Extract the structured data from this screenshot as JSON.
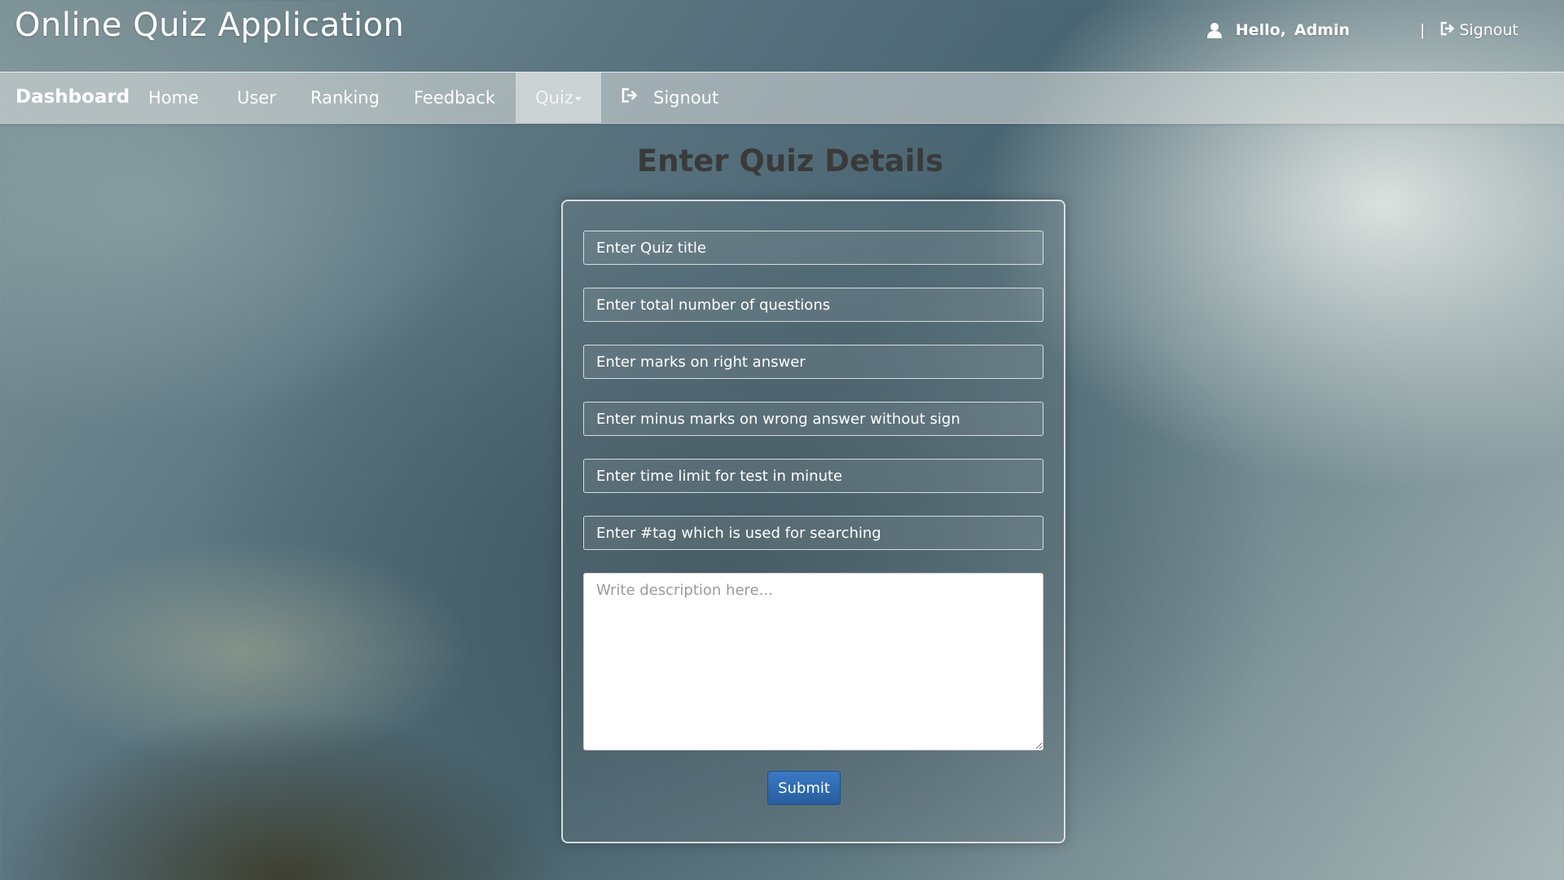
{
  "header": {
    "app_title": "Online Quiz Application",
    "hello": "Hello,",
    "user_name": "Admin",
    "separator": "|",
    "signout": "Signout"
  },
  "nav": {
    "brand": "Dashboard",
    "items": [
      {
        "label": "Home"
      },
      {
        "label": "User"
      },
      {
        "label": "Ranking"
      },
      {
        "label": "Feedback"
      },
      {
        "label": "Quiz",
        "active": true,
        "dropdown": true
      },
      {
        "label": "Signout",
        "icon": "signout-icon"
      }
    ]
  },
  "page": {
    "heading": "Enter Quiz Details"
  },
  "form": {
    "fields": [
      {
        "placeholder": "Enter Quiz title",
        "value": ""
      },
      {
        "placeholder": "Enter total number of questions",
        "value": ""
      },
      {
        "placeholder": "Enter marks on right answer",
        "value": ""
      },
      {
        "placeholder": "Enter minus marks on wrong answer without sign",
        "value": ""
      },
      {
        "placeholder": "Enter time limit for test in minute",
        "value": ""
      },
      {
        "placeholder": "Enter #tag which is used for searching",
        "value": ""
      }
    ],
    "description_placeholder": "Write description here...",
    "submit_label": "Submit"
  },
  "colors": {
    "submit_button": "#2b66aa",
    "heading_text": "#3a3a3a",
    "nav_active_bg": "#e6e9e8"
  }
}
